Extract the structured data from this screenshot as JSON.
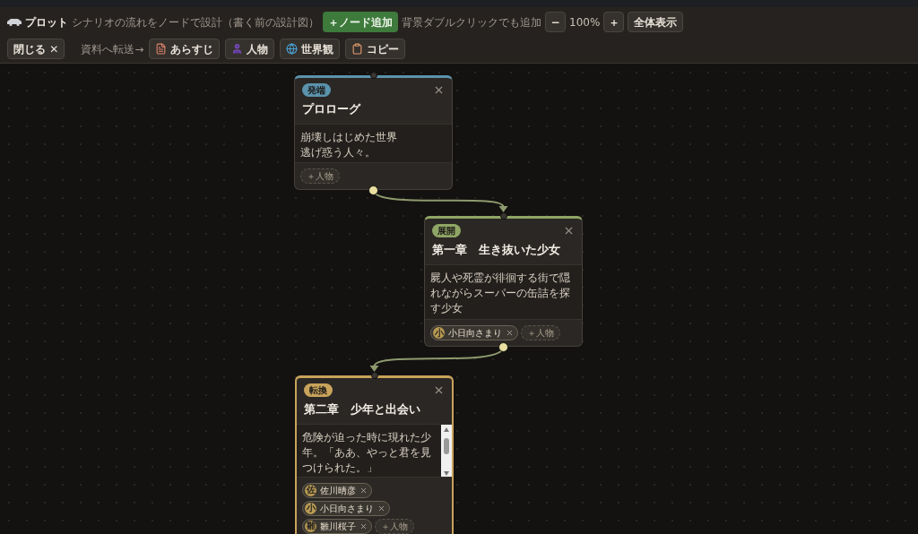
{
  "header": {
    "title": "プロット",
    "subtitle": "シナリオの流れをノードで設計（書く前の設計図）",
    "add_button": "＋ノード追加",
    "add_hint": "背景ダブルクリックでも追加",
    "zoom_out": "−",
    "zoom_level": "100%",
    "zoom_in": "＋",
    "fit_button": "全体表示",
    "export_label": "資料へ転送→",
    "export_buttons": [
      {
        "kind": "synopsis",
        "label": "あらすじ"
      },
      {
        "kind": "character",
        "label": "人物"
      },
      {
        "kind": "world",
        "label": "世界観"
      },
      {
        "kind": "copy",
        "label": "コピー"
      }
    ],
    "close_button": "閉じる ✕"
  },
  "nodes": [
    {
      "tag": "発端",
      "color": "#5b93ad",
      "title": "プロローグ",
      "lines": [
        "崩壊しはじめた世界",
        "逃げ惑う人々。"
      ],
      "selected": false,
      "add_character": "＋人物"
    },
    {
      "tag": "展開",
      "color": "#8fa565",
      "title": "第一章　生き抜いた少女",
      "lines": [
        "屍人や死霊が徘徊する街で隠れながらスーパーの缶詰を探す少女"
      ],
      "selected": false,
      "characters": [
        {
          "initial": "小",
          "name": "小日向さまり"
        }
      ],
      "add_character": "＋人物"
    },
    {
      "tag": "転換",
      "color": "#c9a35b",
      "title": "第二章　少年と出会い",
      "lines": [
        "危険が迫った時に現れた少年。「ああ、やっと君を見つけられた。」"
      ],
      "selected": true,
      "characters": [
        {
          "initial": "佐",
          "name": "佐川晴彦"
        },
        {
          "initial": "小",
          "name": "小日向さまり"
        },
        {
          "initial": "雛",
          "name": "雛川桜子"
        }
      ],
      "add_character": "＋人物"
    }
  ]
}
